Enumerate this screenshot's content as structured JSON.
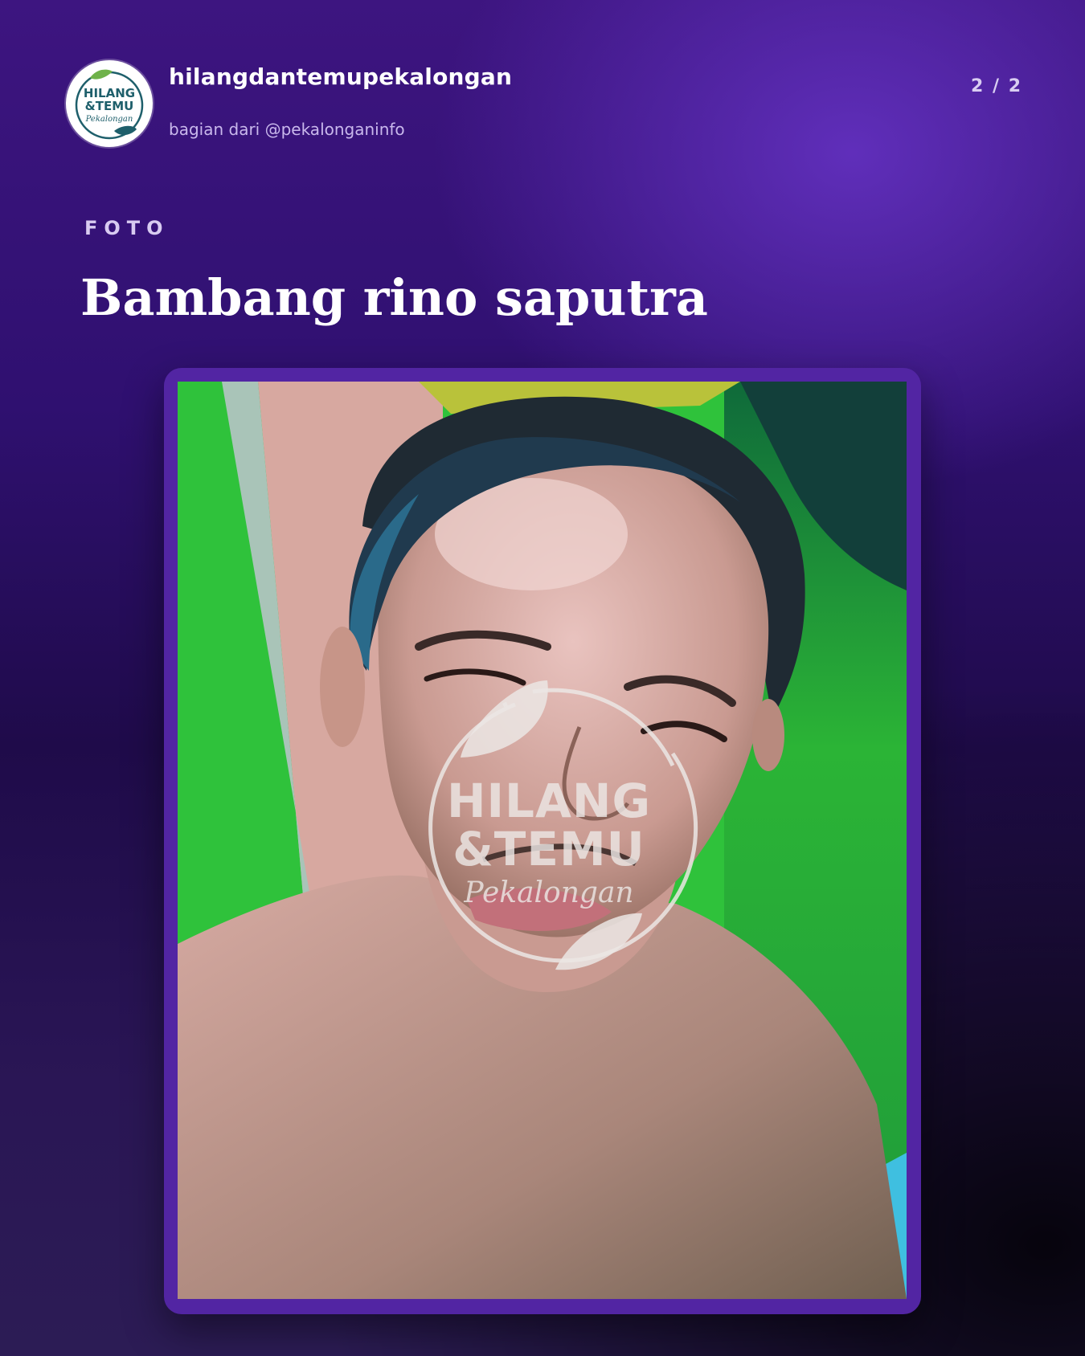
{
  "header": {
    "account_name": "hilangdantemupekalongan",
    "account_subtitle": "bagian dari @pekalonganinfo",
    "avatar_logo": {
      "line1": "HILANG",
      "line2": "&TEMU",
      "line3": "Pekalongan"
    },
    "pager": "2 / 2"
  },
  "content": {
    "section_label": "FOTO",
    "person_name": "Bambang rino saputra"
  },
  "photo": {
    "watermark": {
      "line1": "HILANG",
      "line2": "&TEMU",
      "line3": "Pekalongan"
    }
  },
  "colors": {
    "background_top": "#3d1580",
    "background_bottom": "#1f0b4a",
    "frame": "#5225a3",
    "logo_teal": "#1e5f6b",
    "logo_green": "#6fb24a",
    "photo_green": "#2ec43a"
  }
}
